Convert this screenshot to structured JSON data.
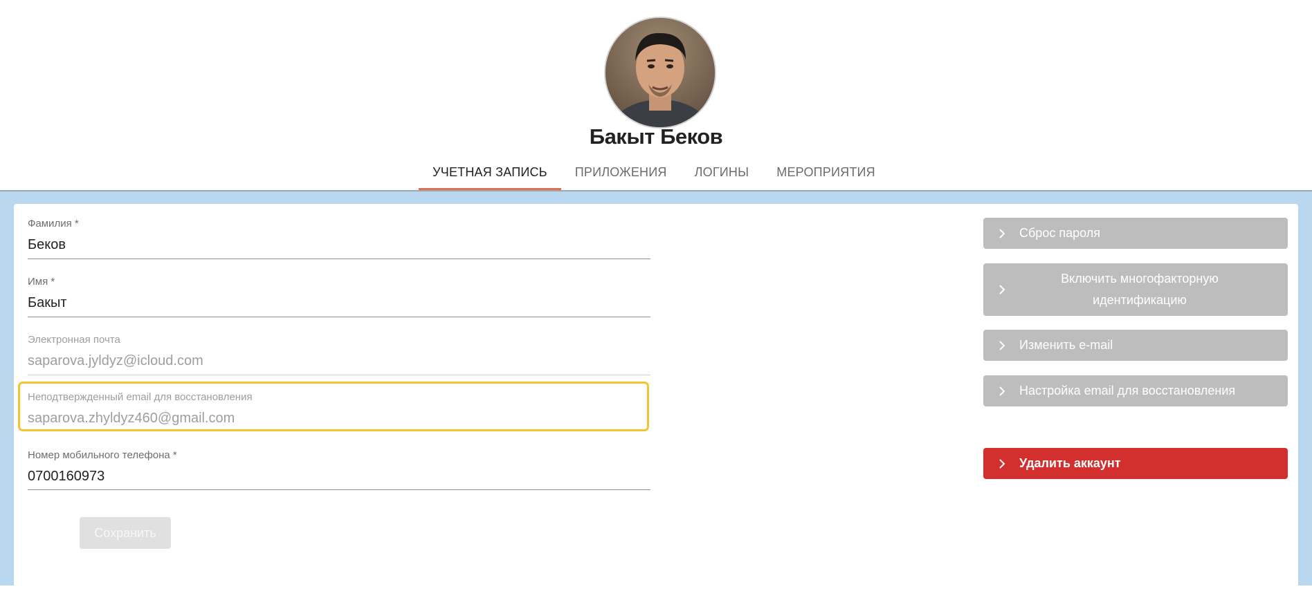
{
  "profile": {
    "name": "Бакыт Беков",
    "avatar_icon": "user-avatar-photo"
  },
  "tabs": [
    {
      "label": "УЧЕТНАЯ ЗАПИСЬ",
      "active": true
    },
    {
      "label": "ПРИЛОЖЕНИЯ",
      "active": false
    },
    {
      "label": "ЛОГИНЫ",
      "active": false
    },
    {
      "label": "МЕРОПРИЯТИЯ",
      "active": false
    }
  ],
  "form": {
    "last_name": {
      "label": "Фамилия *",
      "value": "Беков"
    },
    "first_name": {
      "label": "Имя *",
      "value": "Бакыт"
    },
    "email": {
      "label": "Электронная почта",
      "value": "saparova.jyldyz@icloud.com"
    },
    "recovery_email": {
      "label": "Неподтвержденный email для восстановления",
      "value": "saparova.zhyldyz460@gmail.com"
    },
    "phone": {
      "label": "Номер мобильного телефона *",
      "value": "0700160973"
    },
    "save_label": "Сохранить"
  },
  "actions": {
    "reset_password": "Сброс пароля",
    "enable_mfa": "Включить многофакторную идентификацию",
    "change_email": "Изменить e-mail",
    "recovery_email_setup": "Настройка email для восстановления",
    "delete_account": "Удалить аккаунт"
  },
  "colors": {
    "accent_tab": "#e0714f",
    "highlight": "#f4c430",
    "danger": "#d32f2f",
    "page_bg": "#b9d7ef"
  }
}
